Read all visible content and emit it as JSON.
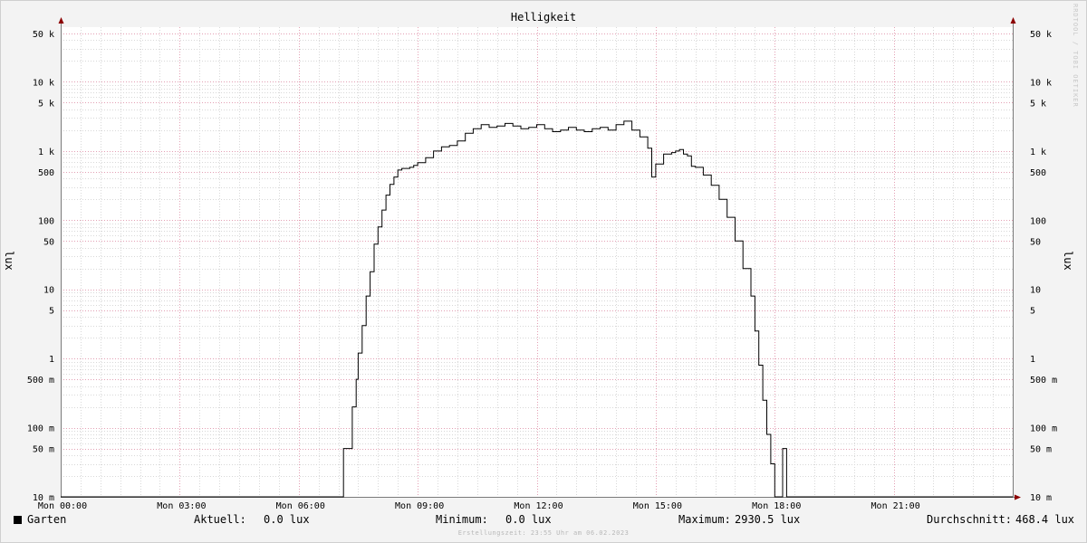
{
  "chart_data": {
    "type": "line",
    "title": "Helligkeit",
    "ylabel": "lux",
    "yscale": "log",
    "ylim": [
      0.01,
      50000
    ],
    "y_ticks": [
      {
        "value": 0.01,
        "label": "10 m"
      },
      {
        "value": 0.05,
        "label": "50 m"
      },
      {
        "value": 0.1,
        "label": "100 m"
      },
      {
        "value": 0.5,
        "label": "500 m"
      },
      {
        "value": 1,
        "label": "1"
      },
      {
        "value": 5,
        "label": "5"
      },
      {
        "value": 10,
        "label": "10"
      },
      {
        "value": 50,
        "label": "50"
      },
      {
        "value": 100,
        "label": "100"
      },
      {
        "value": 500,
        "label": "500"
      },
      {
        "value": 1000,
        "label": "1 k"
      },
      {
        "value": 5000,
        "label": "5 k"
      },
      {
        "value": 10000,
        "label": "10 k"
      },
      {
        "value": 50000,
        "label": "50 k"
      }
    ],
    "x_ticks": [
      {
        "hour": 0,
        "label": "Mon 00:00"
      },
      {
        "hour": 3,
        "label": "Mon 03:00"
      },
      {
        "hour": 6,
        "label": "Mon 06:00"
      },
      {
        "hour": 9,
        "label": "Mon 09:00"
      },
      {
        "hour": 12,
        "label": "Mon 12:00"
      },
      {
        "hour": 15,
        "label": "Mon 15:00"
      },
      {
        "hour": 18,
        "label": "Mon 18:00"
      },
      {
        "hour": 21,
        "label": "Mon 21:00"
      }
    ],
    "xlim_hours": [
      0,
      24
    ],
    "grid": true,
    "series": [
      {
        "name": "Garten",
        "color": "#000000",
        "x_hours": [
          0,
          7.12,
          7.13,
          7.3,
          7.35,
          7.45,
          7.5,
          7.6,
          7.7,
          7.8,
          7.9,
          8.0,
          8.1,
          8.2,
          8.3,
          8.4,
          8.5,
          8.6,
          8.7,
          8.8,
          8.9,
          9.0,
          9.2,
          9.4,
          9.6,
          9.8,
          10.0,
          10.2,
          10.4,
          10.6,
          10.8,
          11.0,
          11.2,
          11.4,
          11.6,
          11.8,
          12.0,
          12.2,
          12.4,
          12.6,
          12.8,
          13.0,
          13.2,
          13.4,
          13.6,
          13.8,
          14.0,
          14.2,
          14.4,
          14.6,
          14.8,
          14.9,
          15.0,
          15.2,
          15.4,
          15.5,
          15.6,
          15.7,
          15.8,
          15.9,
          16.0,
          16.2,
          16.4,
          16.6,
          16.8,
          17.0,
          17.2,
          17.4,
          17.5,
          17.6,
          17.7,
          17.8,
          17.9,
          18.0,
          18.1,
          18.2,
          18.3,
          18.4,
          18.5,
          18.6,
          18.7,
          18.8,
          18.9,
          19.0,
          19.1,
          19.2,
          19.3,
          19.35,
          19.4,
          24
        ],
        "values": [
          0.01,
          0.01,
          0.05,
          0.05,
          0.2,
          0.5,
          1.2,
          3,
          8,
          18,
          45,
          80,
          140,
          230,
          330,
          420,
          530,
          560,
          560,
          580,
          620,
          680,
          800,
          1000,
          1150,
          1200,
          1400,
          1800,
          2100,
          2400,
          2200,
          2300,
          2500,
          2300,
          2100,
          2200,
          2400,
          2100,
          1900,
          2000,
          2200,
          2000,
          1900,
          2100,
          2200,
          2000,
          2400,
          2700,
          2000,
          1600,
          1100,
          420,
          650,
          900,
          950,
          1000,
          1050,
          900,
          850,
          600,
          580,
          450,
          320,
          200,
          110,
          50,
          20,
          8,
          2.5,
          0.8,
          0.25,
          0.08,
          0.03,
          0.01,
          0.01,
          0.05,
          0.01,
          0.01,
          0.01,
          0.01,
          0.01,
          0.01,
          0.01,
          0.01,
          0.01,
          0.01,
          0.01,
          0.01,
          0.01,
          0.01
        ]
      }
    ]
  },
  "legend": {
    "series_name": "Garten",
    "aktuell_label": "Aktuell:",
    "aktuell_value": "0.0 lux",
    "minimum_label": "Minimum:",
    "minimum_value": "0.0 lux",
    "maximum_label": "Maximum:",
    "maximum_value": "2930.5 lux",
    "durchschnitt_label": "Durchschnitt:",
    "durchschnitt_value": "468.4 lux"
  },
  "footer": "Erstellungszeit: 23:55 Uhr am 06.02.2023",
  "watermark": "RRDTOOL / TOBI OETIKER",
  "colors": {
    "background": "#f3f3f3",
    "plot_background": "#ffffff",
    "major_grid": "#e3a0b4",
    "minor_grid": "#d8d8d8",
    "axis": "#7a7a7a",
    "arrow": "#8b0000",
    "line": "#000000"
  }
}
